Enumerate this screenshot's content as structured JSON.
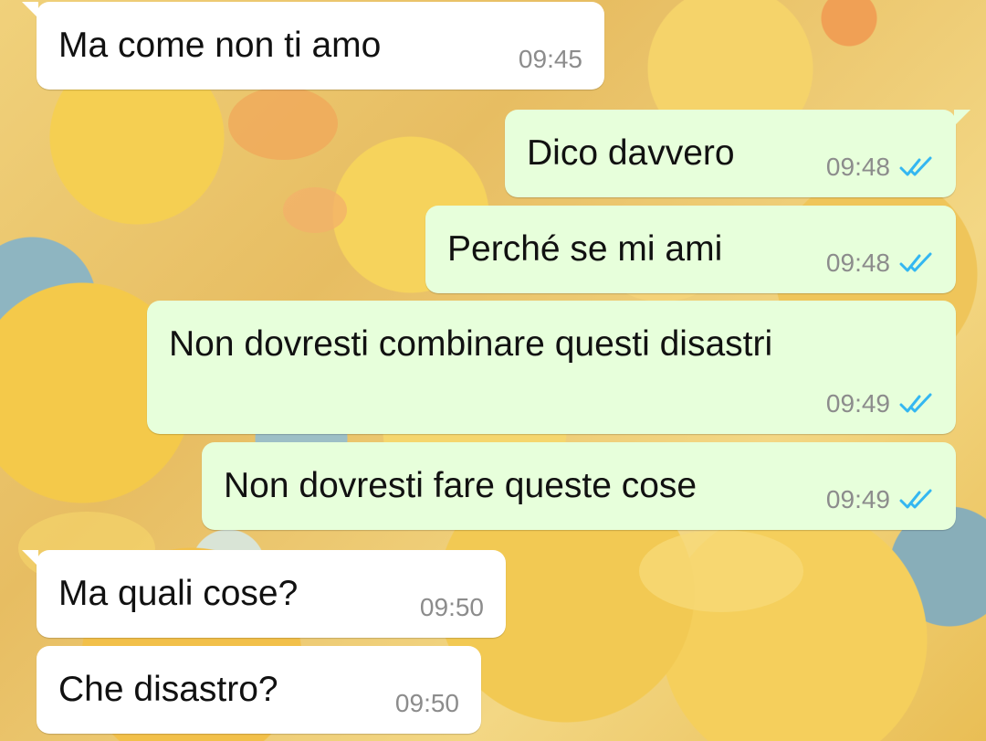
{
  "messages": [
    {
      "direction": "incoming",
      "text": "Ma come non ti amo",
      "time": "09:45"
    },
    {
      "direction": "outgoing",
      "text": "Dico davvero",
      "time": "09:48",
      "status": "read"
    },
    {
      "direction": "outgoing",
      "text": "Perché se mi ami",
      "time": "09:48",
      "status": "read"
    },
    {
      "direction": "outgoing",
      "text": "Non dovresti combinare questi disastri",
      "time": "09:49",
      "status": "read"
    },
    {
      "direction": "outgoing",
      "text": "Non dovresti fare queste cose",
      "time": "09:49",
      "status": "read"
    },
    {
      "direction": "incoming",
      "text": "Ma quali cose?",
      "time": "09:50"
    },
    {
      "direction": "incoming",
      "text": "Che disastro?",
      "time": "09:50"
    }
  ],
  "icons": {
    "read_status": "double-check-icon"
  },
  "colors": {
    "incoming_bubble": "#ffffff",
    "outgoing_bubble": "#e7ffdb",
    "timestamp": "#8c8c8c",
    "read_ticks": "#34b7f1"
  }
}
